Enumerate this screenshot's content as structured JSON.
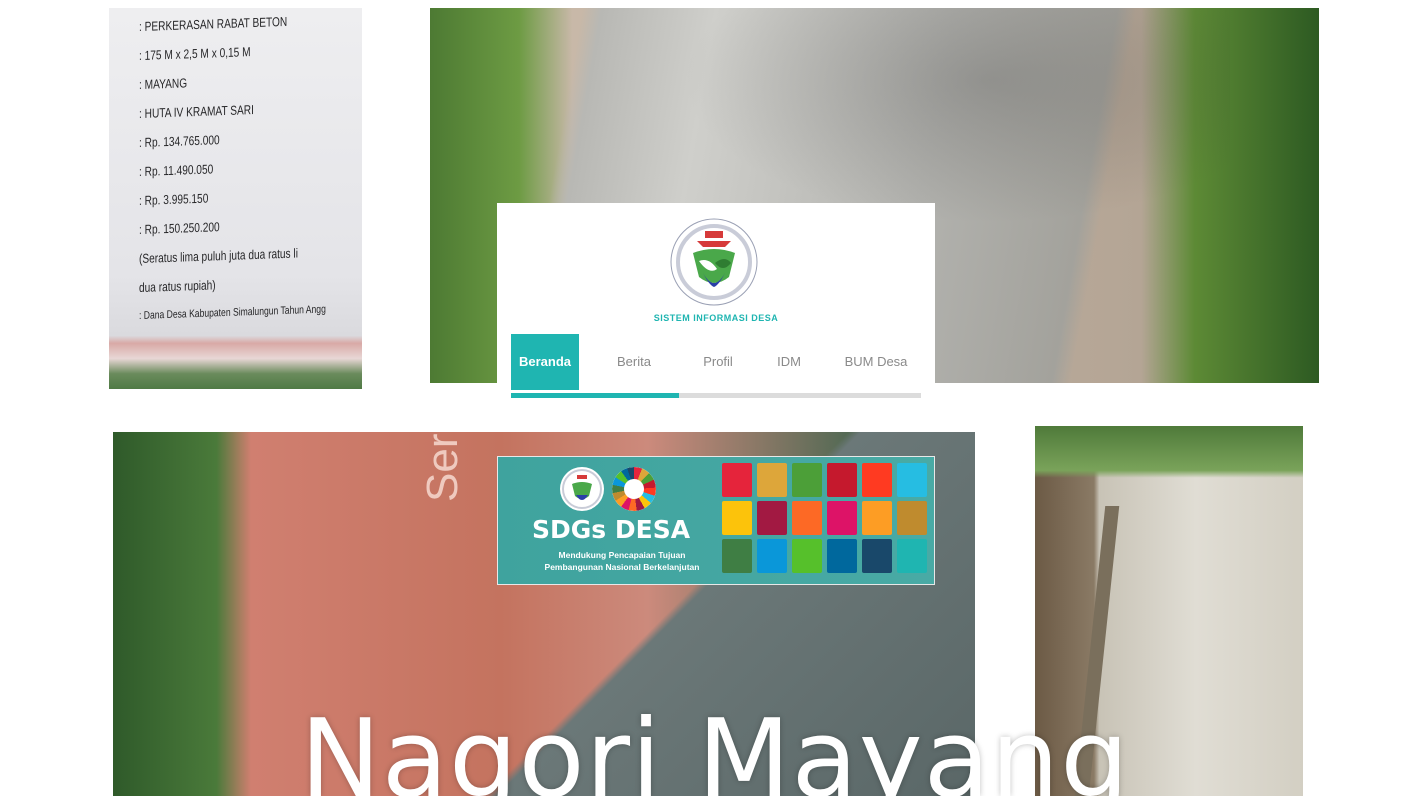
{
  "signboard": {
    "lines": [
      ": PERKERASAN RABAT BETON",
      ": 175 M x 2,5 M x 0,15 M",
      ": MAYANG",
      ": HUTA IV KRAMAT SARI",
      ": Rp.  134.765.000",
      ": Rp.   11.490.050",
      ": Rp.    3.995.150",
      ": Rp.  150.250.200",
      "  (Seratus lima puluh juta dua ratus li",
      "  dua ratus rupiah)",
      ": Dana Desa Kabupaten Simalungun Tahun Angg"
    ]
  },
  "cement_bag": {
    "text": "Serba Guna"
  },
  "overlay_title": "Nagori Mayang",
  "site": {
    "name": "SISTEM INFORMASI DESA",
    "logo_icon": "kemendesa-logo-icon",
    "nav": [
      {
        "label": "Beranda",
        "active": true
      },
      {
        "label": "Berita",
        "active": false
      },
      {
        "label": "Profil",
        "active": false
      },
      {
        "label": "IDM",
        "active": false
      },
      {
        "label": "BUM Desa",
        "active": false
      }
    ],
    "nav_progress": 0.41
  },
  "sdgs": {
    "title": "SDGs DESA",
    "subtitle_line1": "Mendukung Pencapaian Tujuan",
    "subtitle_line2": "Pembangunan Nasional Berkelanjutan",
    "tile_colors": [
      "#e5243b",
      "#dda63a",
      "#4c9f38",
      "#c5192d",
      "#ff3a21",
      "#26bde2",
      "#fcc30b",
      "#a21942",
      "#fd6925",
      "#dd1367",
      "#fd9d24",
      "#bf8b2e",
      "#3f7e44",
      "#0a97d9",
      "#56c02b",
      "#00689d",
      "#19486a",
      "#1fb5b1"
    ]
  },
  "colors": {
    "accent": "#1fb5b1",
    "nav_inactive": "#8a8a8a",
    "banner": "#45a7a2"
  }
}
